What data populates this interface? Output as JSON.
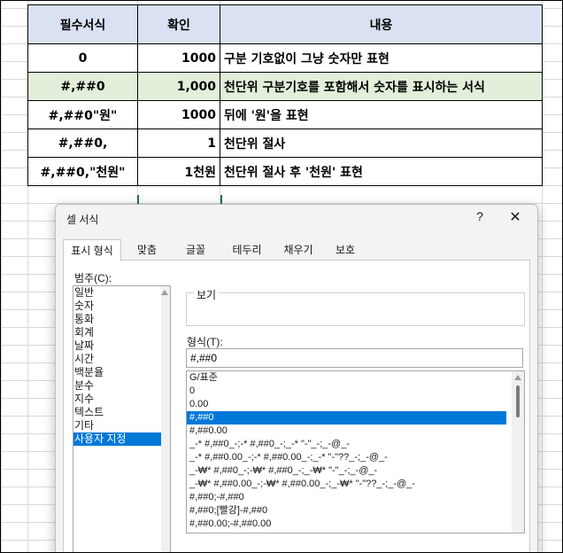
{
  "table": {
    "headers": [
      "필수서식",
      "확인",
      "내용"
    ],
    "rows": [
      {
        "format": "0",
        "check": "1000",
        "desc": "구분 기호없이 그냥 숫자만 표현",
        "highlight": false
      },
      {
        "format": "#,##0",
        "check": "1,000",
        "desc": "천단위 구분기호를 포함해서 숫자를 표시하는 서식",
        "highlight": true
      },
      {
        "format": "#,##0\"원\"",
        "check": "1000",
        "desc": "뒤에 '원'을 표현",
        "highlight": false
      },
      {
        "format": "#,##0,",
        "check": "1",
        "desc": "천단위 절사",
        "highlight": false
      },
      {
        "format": "#,##0,\"천원\"",
        "check": "1천원",
        "desc": "천단위 절사 후 '천원' 표현",
        "highlight": false
      }
    ]
  },
  "dialog": {
    "title": "셀 서식",
    "help": "?",
    "close": "✕",
    "tabs": [
      "표시 형식",
      "맞춤",
      "글꼴",
      "테두리",
      "채우기",
      "보호"
    ],
    "active_tab": 0,
    "category_label": "범주(C):",
    "categories": [
      "일반",
      "숫자",
      "통화",
      "회계",
      "날짜",
      "시간",
      "백분율",
      "분수",
      "지수",
      "텍스트",
      "기타",
      "사용자 지정"
    ],
    "selected_category": 11,
    "preview_label": "보기",
    "format_label": "형식(T):",
    "format_value": "#,##0",
    "format_options": [
      "G/표준",
      "0",
      "0.00",
      "#,##0",
      "#,##0.00",
      "_-* #,##0_-;-* #,##0_-;_-* \"-\"_-;_-@_-",
      "_-* #,##0.00_-;-* #,##0.00_-;_-* \"-\"??_-;_-@_-",
      "_-₩* #,##0_-;-₩* #,##0_-;_-₩* \"-\"_-;_-@_-",
      "_-₩* #,##0.00_-;-₩* #,##0.00_-;_-₩* \"-\"??_-;_-@_-",
      "#,##0;-#,##0",
      "#,##0;[빨강]-#,##0",
      "#,##0.00;-#,##0.00"
    ],
    "selected_format": 3
  }
}
